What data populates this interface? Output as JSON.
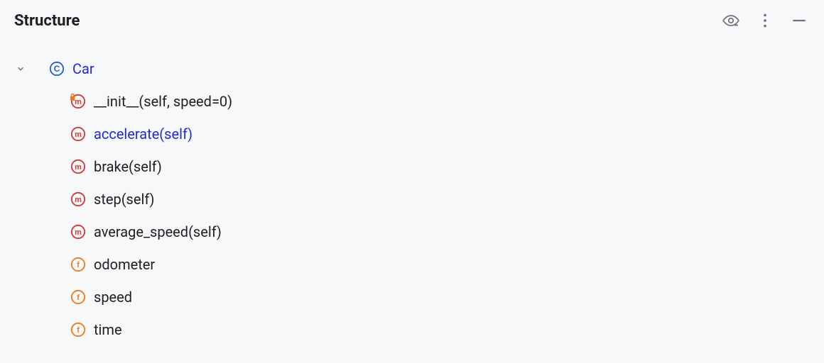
{
  "panel": {
    "title": "Structure"
  },
  "class": {
    "name": "Car",
    "members": [
      {
        "icon": "method-lock",
        "label": "__init__(self, speed=0)",
        "link": false
      },
      {
        "icon": "method",
        "label": "accelerate(self)",
        "link": true
      },
      {
        "icon": "method",
        "label": "brake(self)",
        "link": false
      },
      {
        "icon": "method",
        "label": "step(self)",
        "link": false
      },
      {
        "icon": "method",
        "label": "average_speed(self)",
        "link": false
      },
      {
        "icon": "field",
        "label": "odometer",
        "link": false
      },
      {
        "icon": "field",
        "label": "speed",
        "link": false
      },
      {
        "icon": "field",
        "label": "time",
        "link": false
      }
    ]
  }
}
